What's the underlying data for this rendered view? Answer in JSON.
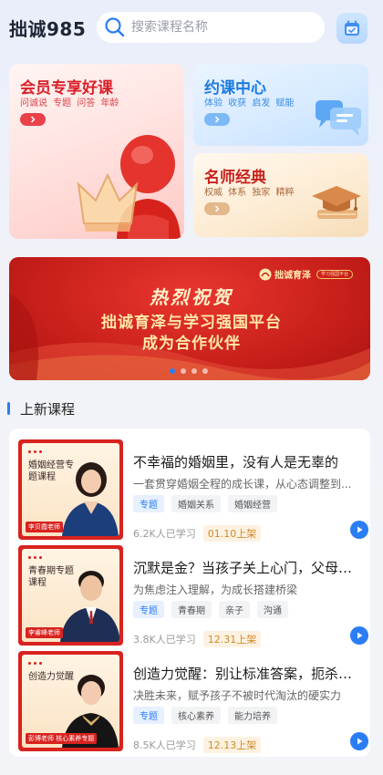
{
  "header": {
    "brand": "拙诚985",
    "search_placeholder": "搜索课程名称"
  },
  "features": {
    "member": {
      "title": "会员专享好课",
      "tags": "问诚说 专题 问答 年龄"
    },
    "booking": {
      "title": "约课中心",
      "tags": "体验 收获 启发 赋能"
    },
    "famous": {
      "title": "名师经典",
      "tags": "权威 体系 独家 精粹"
    }
  },
  "banner": {
    "logo_text": "拙诚育泽",
    "logo_sub": "学习强国平台",
    "line1": "热烈祝贺",
    "line2": "拙诚育泽与学习强国平台",
    "line3": "成为合作伙伴",
    "slides": 4,
    "active_slide": 1
  },
  "section": {
    "title": "上新课程"
  },
  "courses": [
    {
      "thumb_label": "婚姻经营专题课程",
      "teacher": "李贝霞老师",
      "title": "不幸福的婚姻里，没有人是无辜的",
      "desc": "一套贯穿婚姻全程的成长课，从心态调整到...",
      "tags": [
        "专题",
        "婚姻关系",
        "婚姻经营"
      ],
      "learners": "6.2K人已学习",
      "date": "01.10上架"
    },
    {
      "thumb_label": "青春期专题课程",
      "teacher": "李睿峰老师",
      "title": "沉默是金？当孩子关上心门，父母该如何...",
      "desc": "为焦虑注入理解，为成长搭建桥梁",
      "tags": [
        "专题",
        "青春期",
        "亲子",
        "沟通"
      ],
      "learners": "3.8K人已学习",
      "date": "12.31上架"
    },
    {
      "thumb_label": "创造力觉醒",
      "teacher": "彭博老师 核心素养专题",
      "title": "创造力觉醒：别让标准答案，扼杀孩子的...",
      "desc": "决胜未来，赋予孩子不被时代淘汰的硬实力",
      "tags": [
        "专题",
        "核心素养",
        "能力培养"
      ],
      "learners": "8.5K人已学习",
      "date": "12.13上架"
    }
  ],
  "colors": {
    "accent": "#2a7df5",
    "red": "#d9202a",
    "banner_red": "#c81f1b"
  }
}
